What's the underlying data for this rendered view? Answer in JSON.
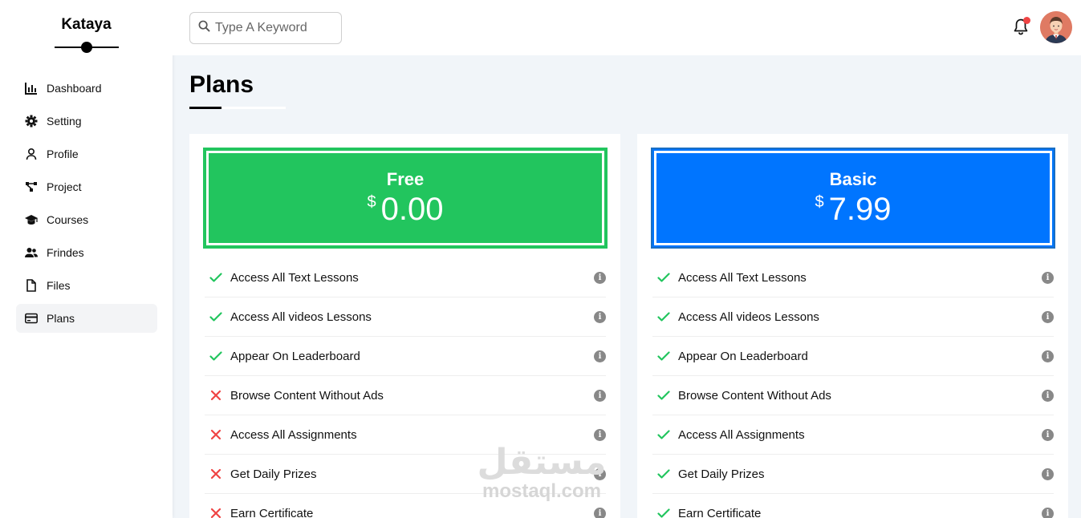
{
  "brand": {
    "name": "Kataya"
  },
  "sidebar": {
    "items": [
      {
        "label": "Dashboard",
        "icon": "chart-icon",
        "active": false
      },
      {
        "label": "Setting",
        "icon": "gear-icon",
        "active": false
      },
      {
        "label": "Profile",
        "icon": "user-icon",
        "active": false
      },
      {
        "label": "Project",
        "icon": "project-icon",
        "active": false
      },
      {
        "label": "Courses",
        "icon": "graduation-cap-icon",
        "active": false
      },
      {
        "label": "Frindes",
        "icon": "users-icon",
        "active": false
      },
      {
        "label": "Files",
        "icon": "file-icon",
        "active": false
      },
      {
        "label": "Plans",
        "icon": "credit-card-icon",
        "active": true
      }
    ]
  },
  "header": {
    "search": {
      "placeholder": "Type A Keyword",
      "value": ""
    },
    "notifications": {
      "has_unread": true
    }
  },
  "main": {
    "title": "Plans",
    "plans": [
      {
        "name": "Free",
        "currency": "$",
        "price": "0.00",
        "color": "#22c55e",
        "features": [
          {
            "label": "Access All Text Lessons",
            "included": true
          },
          {
            "label": "Access All videos Lessons",
            "included": true
          },
          {
            "label": "Appear On Leaderboard",
            "included": true
          },
          {
            "label": "Browse Content Without Ads",
            "included": false
          },
          {
            "label": "Access All Assignments",
            "included": false
          },
          {
            "label": "Get Daily Prizes",
            "included": false
          },
          {
            "label": "Earn Certificate",
            "included": false
          }
        ]
      },
      {
        "name": "Basic",
        "currency": "$",
        "price": "7.99",
        "color": "#0075ff",
        "features": [
          {
            "label": "Access All Text Lessons",
            "included": true
          },
          {
            "label": "Access All videos Lessons",
            "included": true
          },
          {
            "label": "Appear On Leaderboard",
            "included": true
          },
          {
            "label": "Browse Content Without Ads",
            "included": true
          },
          {
            "label": "Access All Assignments",
            "included": true
          },
          {
            "label": "Get Daily Prizes",
            "included": true
          },
          {
            "label": "Earn Certificate",
            "included": true
          }
        ]
      }
    ]
  },
  "watermark": {
    "arabic": "مستقل",
    "latin": "mostaql.com"
  },
  "colors": {
    "check": "#22c55e",
    "cross": "#ef4444",
    "info": "#888888"
  }
}
